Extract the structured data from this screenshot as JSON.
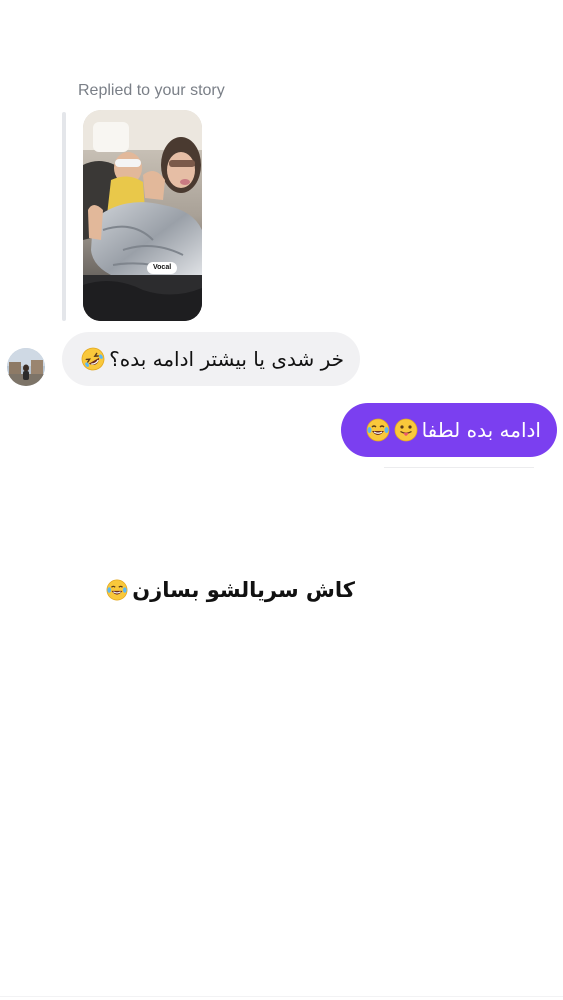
{
  "thread": {
    "reply_context_label": "Replied to your story",
    "story_sticker_label": "Vocal",
    "messages": [
      {
        "direction": "incoming",
        "text": "خر شدی یا بیشتر ادامه بده؟",
        "emoji": "rolling-on-floor-laughing-emoji"
      },
      {
        "direction": "outgoing",
        "text": "ادامه بده لطفا",
        "emojis": [
          "face-with-tongue-emoji",
          "tears-of-joy-emoji"
        ]
      }
    ]
  },
  "overlay_caption": {
    "text": "کاش سریالشو بسازن",
    "emoji": "tears-of-joy-emoji"
  },
  "colors": {
    "outgoing_bubble": "#7b3ff0",
    "incoming_bubble": "#f1f1f3",
    "label_gray": "#7a7f87"
  }
}
